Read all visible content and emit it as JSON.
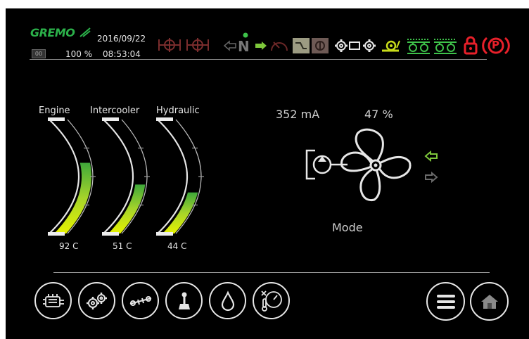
{
  "header": {
    "brand": "GREMO",
    "date": "2016/09/22",
    "time": "08:53:04",
    "percentage": "100 %",
    "small_badge": "00",
    "icons": [
      "axle-lock-icon",
      "axle-lock-icon",
      "direction-left-arrow-icon",
      "neutral-gear-icon",
      "direction-right-arrow-icon",
      "speedometer-icon",
      "slope-mode-icon",
      "incline-mode-icon",
      "drive-gears-icon",
      "snail-slow-icon",
      "bogie-track-icon",
      "bogie-track-icon",
      "lock-icon",
      "parking-brake-icon"
    ],
    "neutral_label": "N",
    "parking_label": "P"
  },
  "gauges": [
    {
      "label": "Engine",
      "value_text": "92 C",
      "level": 0.62
    },
    {
      "label": "Intercooler",
      "value_text": "51 C",
      "level": 0.43
    },
    {
      "label": "Hydraulic",
      "value_text": "44 C",
      "level": 0.36
    }
  ],
  "fan": {
    "current": "352 mA",
    "percent": "47 %",
    "mode_label": "Mode",
    "active_direction": "left",
    "colors": {
      "active": "#7ec83b",
      "inactive": "#6a6a6a"
    }
  },
  "bottom_nav": {
    "left_buttons": [
      "engine-icon",
      "gears-icon",
      "driveshaft-icon",
      "joystick-icon",
      "oil-drop-icon",
      "temperature-gauge-icon"
    ],
    "right_buttons": [
      "menu-icon",
      "home-icon"
    ]
  },
  "colors": {
    "background": "#000000",
    "text": "#e6e6e6",
    "accent_green": "#7ec83b",
    "alert_red": "#e8202a",
    "dim_red": "#7a2d2d"
  }
}
